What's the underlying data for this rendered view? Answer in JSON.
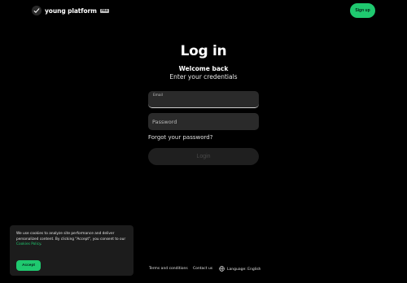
{
  "header": {
    "brand_name": "young platform",
    "brand_badge": "PRO",
    "signup_label": "Sign up"
  },
  "login": {
    "title": "Log in",
    "welcome": "Welcome back",
    "subtitle": "Enter your credentials",
    "email_label": "Email",
    "email_value": "",
    "password_placeholder": "Password",
    "forgot_label": "Forgot your password?",
    "submit_label": "Login"
  },
  "cookie_banner": {
    "text": "We use cookies to analyze site performance and deliver personalized content. By clicking \"Accept\", you consent to our",
    "link_label": "Cookies Policy",
    "link_suffix": ".",
    "accept_label": "Accept"
  },
  "footer": {
    "terms_label": "Terms and conditions",
    "contact_label": "Contact us",
    "language_label": "Language: English"
  },
  "colors": {
    "background": "#000000",
    "accent": "#1fc96f",
    "field_bg": "#2a2a2a",
    "disabled_button": "#1f1f1f"
  },
  "icons": {
    "brand": "young-platform-logo-icon",
    "language": "globe-icon"
  }
}
